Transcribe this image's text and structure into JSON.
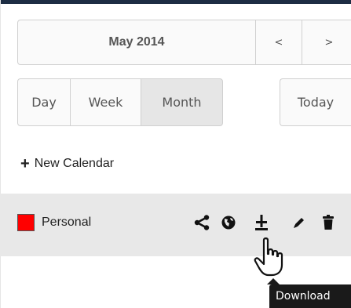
{
  "navigator": {
    "month_label": "May 2014",
    "prev_label": "<",
    "next_label": ">"
  },
  "views": {
    "day_label": "Day",
    "week_label": "Week",
    "month_label": "Month",
    "today_label": "Today",
    "active_view": "Month"
  },
  "new_calendar": {
    "label": "New Calendar"
  },
  "calendars": [
    {
      "name": "Personal",
      "color": "#ff0000",
      "actions": [
        "share-icon",
        "public-icon",
        "download-icon",
        "edit-icon",
        "delete-icon"
      ]
    }
  ],
  "tooltip": {
    "text": "Download"
  },
  "colors": {
    "header_bar": "#1d2d44",
    "row_background": "#e8e8e8",
    "active_button": "#e6e6e6",
    "tooltip_background": "#1a1a1a"
  }
}
